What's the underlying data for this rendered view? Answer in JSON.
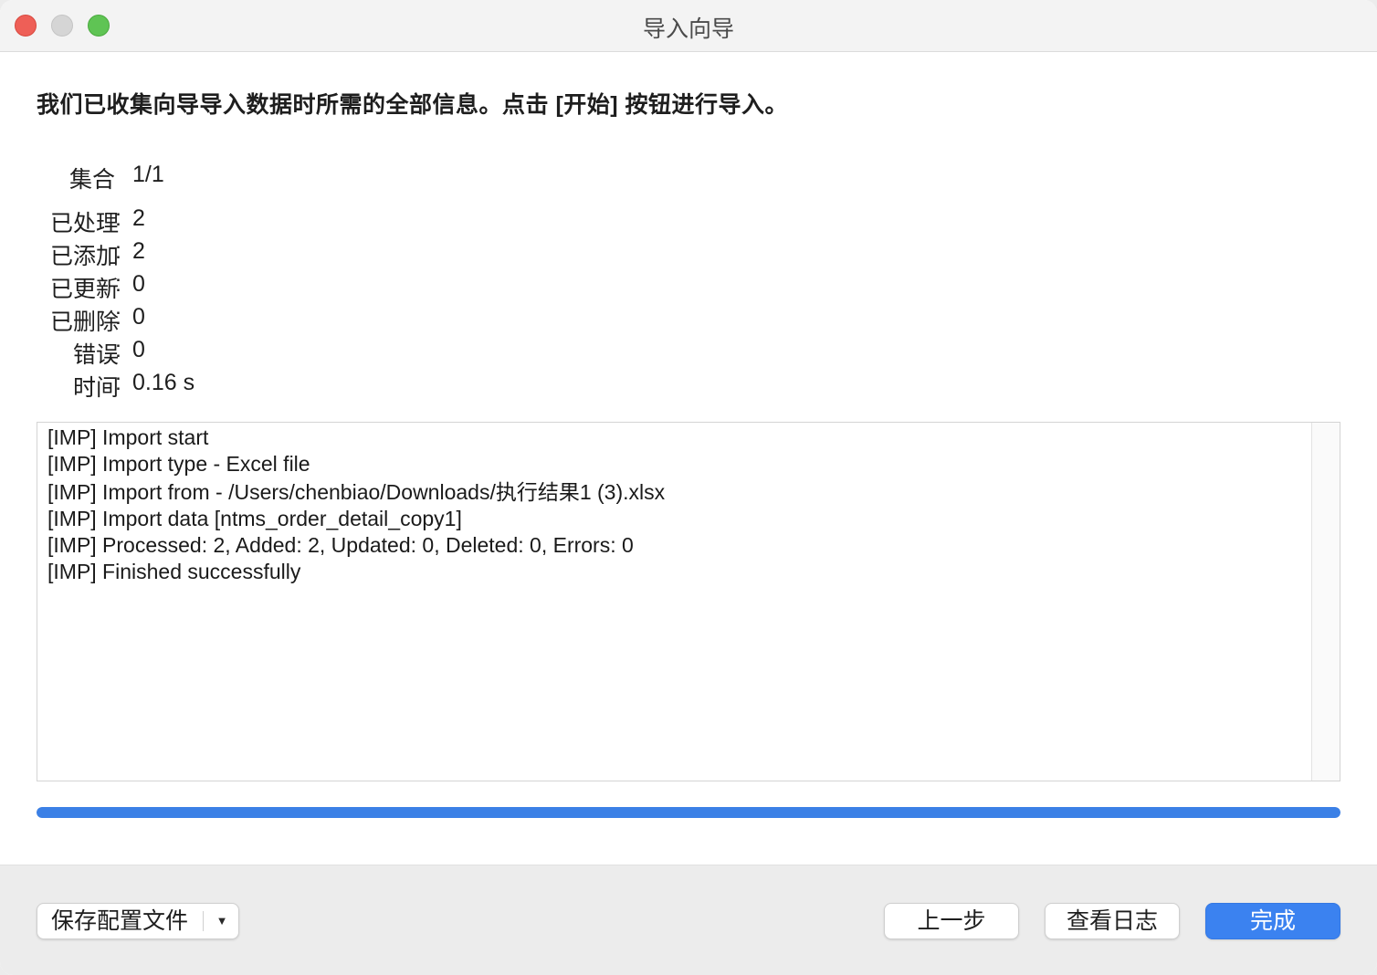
{
  "window": {
    "title": "导入向导"
  },
  "intro": {
    "text": "我们已收集向导导入数据时所需的全部信息。点击 [开始] 按钮进行导入。"
  },
  "stats": [
    {
      "label": "集合",
      "colon": "",
      "value": "1/1"
    },
    {
      "label": "已处理",
      "colon": ":",
      "value": "2"
    },
    {
      "label": "已添加",
      "colon": ":",
      "value": "2"
    },
    {
      "label": "已更新",
      "colon": ":",
      "value": "0"
    },
    {
      "label": "已删除",
      "colon": ":",
      "value": "0"
    },
    {
      "label": "错误",
      "colon": ":",
      "value": "0"
    },
    {
      "label": "时间",
      "colon": ":",
      "value": "0.16 s"
    }
  ],
  "log": {
    "lines": [
      "[IMP] Import start",
      "[IMP] Import type - Excel file",
      "[IMP] Import from - /Users/chenbiao/Downloads/执行结果1 (3).xlsx",
      "[IMP] Import data [ntms_order_detail_copy1]",
      "[IMP] Processed: 2, Added: 2, Updated: 0, Deleted: 0, Errors: 0",
      "[IMP] Finished successfully"
    ]
  },
  "progress": {
    "fraction": 1.0,
    "color": "#3b80e6"
  },
  "footer": {
    "save_profile_label": "保存配置文件",
    "save_profile_arrow": "▼",
    "back_label": "上一步",
    "view_log_label": "查看日志",
    "finish_label": "完成"
  },
  "colors": {
    "accent": "#3b82f0",
    "close": "#ee5f57",
    "zoom": "#5fc454"
  }
}
